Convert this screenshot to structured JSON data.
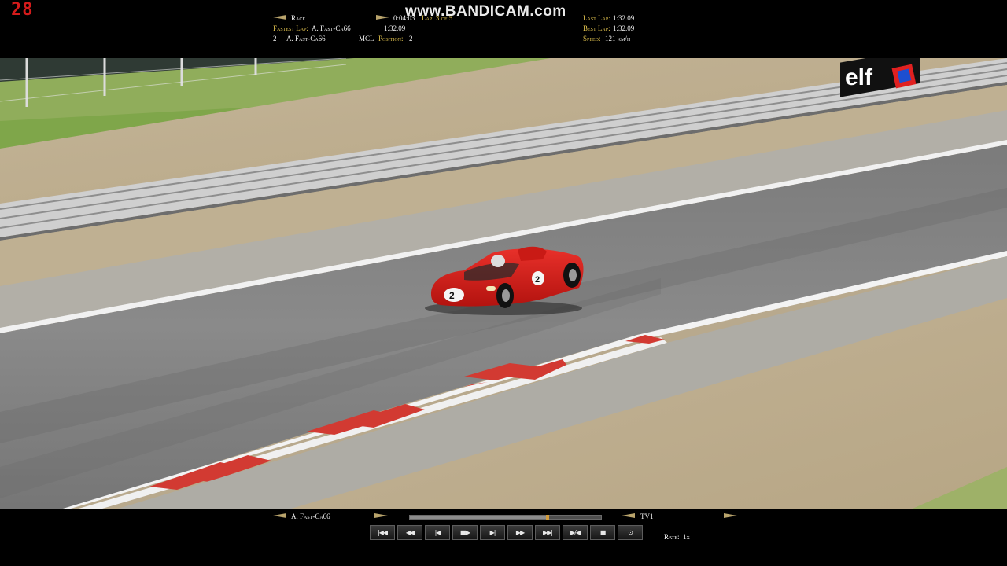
{
  "fps_counter": "28",
  "watermark": "www.BANDICAM.com",
  "hud": {
    "session_label": "Race",
    "elapsed_time": "0:04:03",
    "laps_label": "Lap: 3 of 5",
    "fastest_lap_label": "Fastest Lap:",
    "fastest_lap_driver": "A. Fast-Ca66",
    "fastest_lap_time": "1:32.09",
    "driver_number": "2",
    "driver_name": "A. Fast-Ca66",
    "team_code": "MCL",
    "position_label": "Position:",
    "position_value": "2",
    "last_lap_label": "Last Lap:",
    "last_lap_time": "1:32.09",
    "best_lap_label": "Best Lap:",
    "best_lap_time": "1:32.09",
    "speed_label": "Speed:",
    "speed_value": "121 km/h"
  },
  "scene": {
    "sponsor_board": "elf",
    "car_number": "2"
  },
  "replay": {
    "driver_name": "A. Fast-Ca66",
    "camera": "TV1",
    "rate_label": "Rate:",
    "rate_value": "1x",
    "progress": 0.72,
    "buttons": [
      {
        "name": "skip-to-start-button",
        "glyph": "|◀◀"
      },
      {
        "name": "rewind-button",
        "glyph": "◀◀"
      },
      {
        "name": "step-back-button",
        "glyph": "|◀"
      },
      {
        "name": "pause-button",
        "glyph": "▮▮▶"
      },
      {
        "name": "step-forward-button",
        "glyph": "▶|"
      },
      {
        "name": "fast-forward-button",
        "glyph": "▶▶"
      },
      {
        "name": "skip-to-end-button",
        "glyph": "▶▶|"
      },
      {
        "name": "frame-step-button",
        "glyph": "▶/◀"
      },
      {
        "name": "stop-button",
        "glyph": "■"
      },
      {
        "name": "record-button",
        "glyph": "⊙"
      }
    ]
  }
}
